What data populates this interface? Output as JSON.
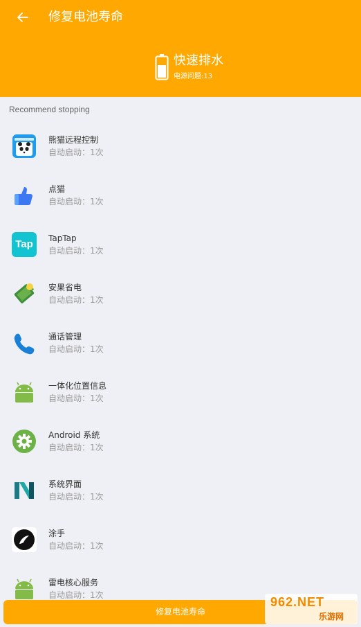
{
  "header": {
    "title": "修复电池寿命",
    "status_title": "快速排水",
    "status_sub": "电源问题:13"
  },
  "section_label": "Recommend stopping",
  "apps": [
    {
      "name": "熊猫远程控制",
      "sub": "自动启动：1次",
      "icon": "panda-remote-icon"
    },
    {
      "name": "点猫",
      "sub": "自动启动：1次",
      "icon": "thumb-icon"
    },
    {
      "name": "TapTap",
      "sub": "自动启动：1次",
      "icon": "taptap-icon",
      "icon_text": "Tap"
    },
    {
      "name": "安果省电",
      "sub": "自动启动：1次",
      "icon": "battery-saver-icon"
    },
    {
      "name": "通话管理",
      "sub": "自动启动：1次",
      "icon": "phone-icon"
    },
    {
      "name": "一体化位置信息",
      "sub": "自动启动：1次",
      "icon": "android-icon"
    },
    {
      "name": "Android 系统",
      "sub": "自动启动：1次",
      "icon": "android-settings-icon"
    },
    {
      "name": "系统界面",
      "sub": "自动启动：1次",
      "icon": "n-logo-icon"
    },
    {
      "name": "涂手",
      "sub": "自动启动：1次",
      "icon": "tushou-icon"
    },
    {
      "name": "雷电核心服务",
      "sub": "自动启动：1次",
      "icon": "android-icon"
    }
  ],
  "button_label": "修复电池寿命",
  "watermark": {
    "top": "962.NET",
    "bottom": "乐游网"
  },
  "colors": {
    "accent": "#fea801",
    "background": "#eff0f5"
  }
}
